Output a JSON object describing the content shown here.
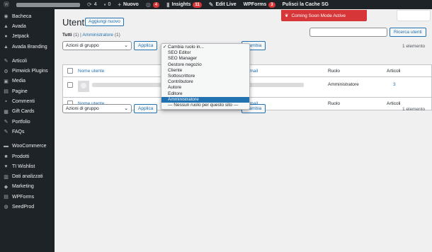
{
  "adminbar": {
    "comments_count": "4",
    "updates_count": "0",
    "new_label": "Nuovo",
    "badge_plugin": "4",
    "insights_label": "Insights",
    "insights_badge": "11",
    "edit_live_label": "Edit Live",
    "wpforms_label": "WPForms",
    "wpforms_badge": "3",
    "cache_label": "Pulisci la Cache SG"
  },
  "sidebar": {
    "items": [
      {
        "label": "Bacheca",
        "icon": "dashboard-icon"
      },
      {
        "label": "Avada",
        "icon": "avada-icon"
      },
      {
        "label": "Jetpack",
        "icon": "jetpack-icon"
      },
      {
        "label": "Avada Branding",
        "icon": "branding-icon"
      },
      {
        "label": "Articoli",
        "icon": "pin-icon"
      },
      {
        "label": "Pimwick Plugins",
        "icon": "plugin-icon"
      },
      {
        "label": "Media",
        "icon": "media-icon"
      },
      {
        "label": "Pagine",
        "icon": "pages-icon"
      },
      {
        "label": "Commenti",
        "icon": "comments-icon"
      },
      {
        "label": "Gift Cards",
        "icon": "giftcard-icon"
      },
      {
        "label": "Portfolio",
        "icon": "portfolio-icon"
      },
      {
        "label": "FAQs",
        "icon": "pin-icon"
      },
      {
        "label": "WooCommerce",
        "icon": "woocommerce-icon"
      },
      {
        "label": "Prodotti",
        "icon": "products-icon"
      },
      {
        "label": "TI Wishlist",
        "icon": "heart-icon"
      },
      {
        "label": "Dati analizzati",
        "icon": "chart-icon"
      },
      {
        "label": "Marketing",
        "icon": "megaphone-icon"
      },
      {
        "label": "WPForms",
        "icon": "forms-icon"
      },
      {
        "label": "SeedProd",
        "icon": "seedprod-icon"
      }
    ]
  },
  "page": {
    "title": "Utenti",
    "add_new_label": "Aggiungi nuovo",
    "views_all": "Tutti",
    "views_all_count": "(1)",
    "views_sep": "|",
    "views_admin": "Amministratore",
    "views_admin_count": "(1)",
    "search_button": "Ricerca utenti",
    "coming_soon": "Coming Soon Mode Active"
  },
  "bulk": {
    "top_select": "Azioni di gruppo",
    "top_apply": "Applica",
    "bottom_select": "Azioni di gruppo",
    "bottom_apply": "Applica",
    "change_apply": "Cambia",
    "count_top": "1 elemento",
    "count_bottom": "1 elemento"
  },
  "table": {
    "headers": {
      "username": "Nome utente",
      "email": "Email",
      "role": "Ruolo",
      "posts": "Articoli"
    },
    "rows": [
      {
        "role": "Amministratore",
        "posts": "3"
      }
    ]
  },
  "role_dropdown": {
    "options": [
      "Cambia ruolo in...",
      "SEO Editor",
      "SEO Manager",
      "Gestore negozio",
      "Cliente",
      "Sottoscrittore",
      "Contributore",
      "Autore",
      "Editore",
      "Amministratore",
      "— Nessun ruolo per questo sito —"
    ],
    "checked": "Cambia ruolo in...",
    "highlighted": "Amministratore"
  },
  "colors": {
    "accent": "#2271b1",
    "adminbar_bg": "#1d2327",
    "notice_red": "#d63638"
  }
}
